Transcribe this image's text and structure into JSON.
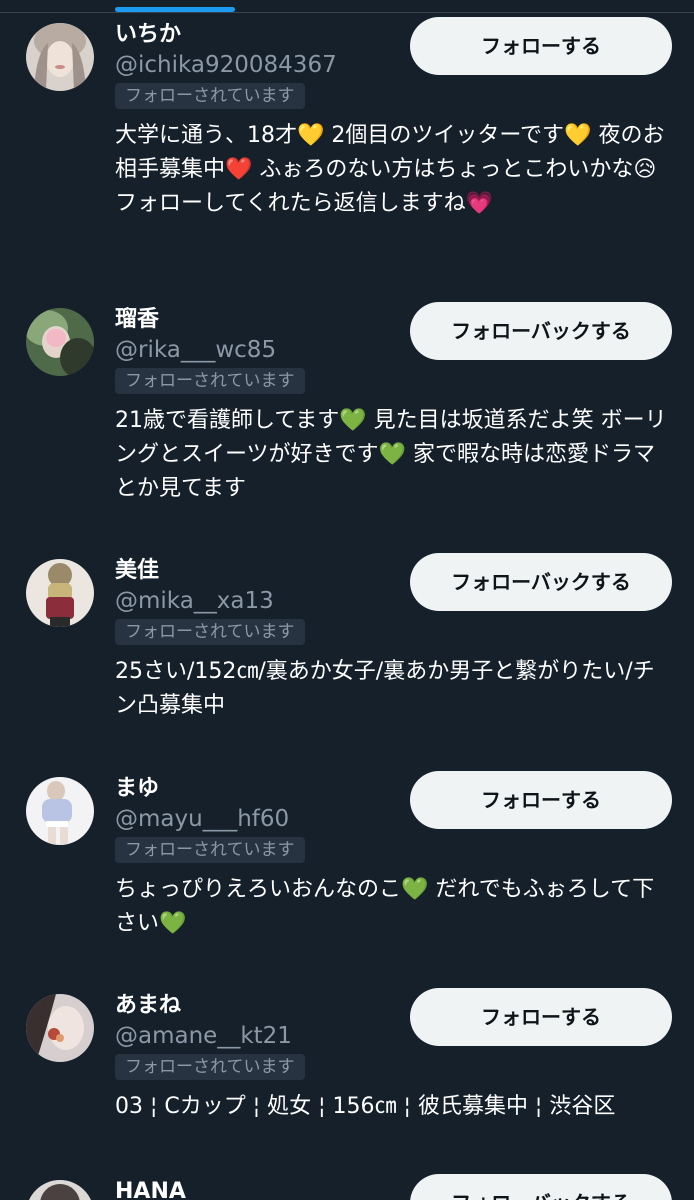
{
  "follow_label_text": "フォローする",
  "follow_back_label_text": "フォローバックする",
  "users": [
    {
      "name": "いちか",
      "handle": "@ichika920084367",
      "badge": "フォローされています",
      "button": "フォローする",
      "bio": "大学に通う、18才💛 2個目のツイッターです💛 夜のお相手募集中❤️ ふぉろのない方はちょっとこわいかな😥 フォローしてくれたら返信しますね💗"
    },
    {
      "name": "瑠香",
      "handle": "@rika___wc85",
      "badge": "フォローされています",
      "button": "フォローバックする",
      "bio": "21歳で看護師してます💚 見た目は坂道系だよ笑 ボーリングとスイーツが好きです💚 家で暇な時は恋愛ドラマとか見てます"
    },
    {
      "name": "美佳",
      "handle": "@mika__xa13",
      "badge": "フォローされています",
      "button": "フォローバックする",
      "bio": "25さい/152㎝/裏あか女子/裏あか男子と繋がりたい/チン凸募集中"
    },
    {
      "name": "まゆ",
      "handle": "@mayu___hf60",
      "badge": "フォローされています",
      "button": "フォローする",
      "bio": "ちょっぴりえろいおんなのこ💚 だれでもふぉろして下さい💚"
    },
    {
      "name": "あまね",
      "handle": "@amane__kt21",
      "badge": "フォローされています",
      "button": "フォローする",
      "bio": "03 ¦ Cカップ ¦ 処女 ¦ 156㎝ ¦ 彼氏募集中 ¦ 渋谷区"
    },
    {
      "name": "HANA",
      "handle": "",
      "badge": "",
      "button": "フォローバックする",
      "bio": ""
    }
  ],
  "colors": {
    "background": "#15202b",
    "accent": "#1d9bf0",
    "button_bg": "#eff3f4",
    "handle_text": "#8b98a5"
  }
}
